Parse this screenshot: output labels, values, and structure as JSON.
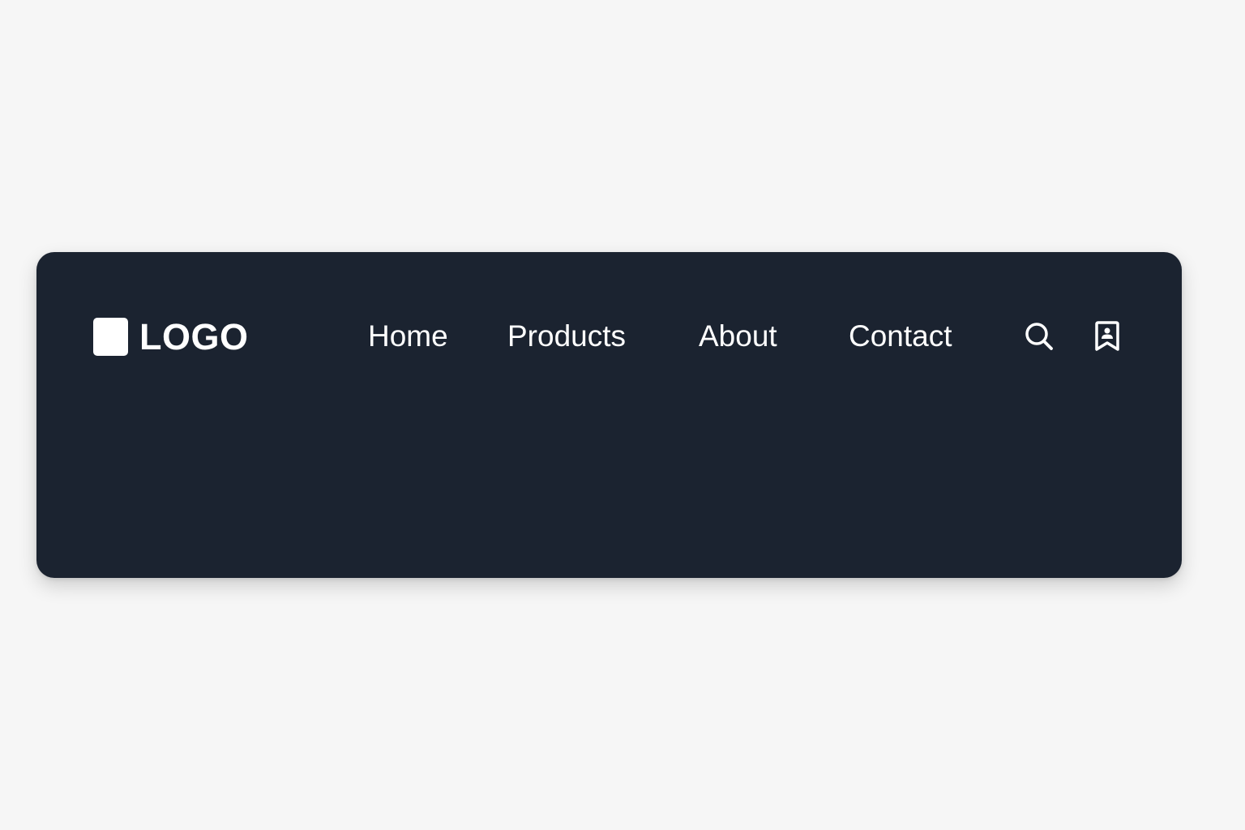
{
  "colors": {
    "page_background": "#f6f6f6",
    "navbar_background": "#1b2330",
    "foreground": "#ffffff"
  },
  "navbar": {
    "logo": {
      "icon": "square-logo-mark",
      "text": "LOGO"
    },
    "links": [
      {
        "label": "Home"
      },
      {
        "label": "Products"
      },
      {
        "label": "About"
      },
      {
        "label": "Contact"
      }
    ],
    "actions": [
      {
        "icon": "search-icon"
      },
      {
        "icon": "bookmark-user-icon"
      }
    ]
  }
}
